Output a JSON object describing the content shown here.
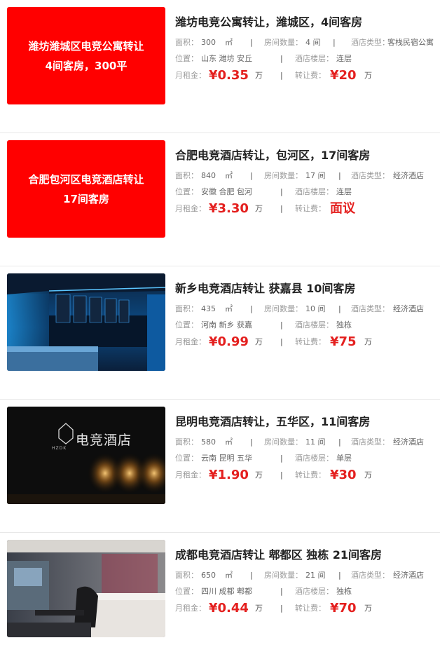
{
  "listings": [
    {
      "thumb": {
        "line1": "潍坊潍城区电竞公寓转让",
        "line2": "4间客房，300平"
      },
      "title": "潍坊电竞公寓转让，潍城区，4间客房",
      "area_label": "面积：",
      "area_value": "300",
      "area_unit": "㎡",
      "rooms_label": "房间数量：",
      "rooms_value": "4 间",
      "type_label": "酒店类型：",
      "type_value": "客栈民宿公寓",
      "location_label": "位置：",
      "location_value": "山东 潍坊 安丘",
      "floor_label": "酒店楼层：",
      "floor_value": "连层",
      "rent_label": "月租金：",
      "rent_value": "¥0.35",
      "rent_unit": "万",
      "fee_label": "转让费：",
      "fee_value": "¥20",
      "fee_unit": "万"
    },
    {
      "thumb": {
        "line1": "合肥包河区电竞酒店转让",
        "line2": "17间客房"
      },
      "title": "合肥电竞酒店转让，包河区，17间客房",
      "area_label": "面积：",
      "area_value": "840",
      "area_unit": "㎡",
      "rooms_label": "房间数量：",
      "rooms_value": "17 间",
      "type_label": "酒店类型：",
      "type_value": "经济酒店",
      "location_label": "位置：",
      "location_value": "安徽 合肥 包河",
      "floor_label": "酒店楼层：",
      "floor_value": "连层",
      "rent_label": "月租金：",
      "rent_value": "¥3.30",
      "rent_unit": "万",
      "fee_label": "转让费：",
      "fee_value": "面议",
      "fee_unit": ""
    },
    {
      "title": "新乡电竞酒店转让 获嘉县 10间客房",
      "area_label": "面积：",
      "area_value": "435",
      "area_unit": "㎡",
      "rooms_label": "房间数量：",
      "rooms_value": "10 间",
      "type_label": "酒店类型：",
      "type_value": "经济酒店",
      "location_label": "位置：",
      "location_value": "河南 新乡 获嘉",
      "floor_label": "酒店楼层：",
      "floor_value": "独栋",
      "rent_label": "月租金：",
      "rent_value": "¥0.99",
      "rent_unit": "万",
      "fee_label": "转让费：",
      "fee_value": "¥75",
      "fee_unit": "万"
    },
    {
      "thumb": {
        "logo_text": "电竞酒店",
        "logo_small": "HZDK"
      },
      "title": "昆明电竞酒店转让，五华区，11间客房",
      "area_label": "面积：",
      "area_value": "580",
      "area_unit": "㎡",
      "rooms_label": "房间数量：",
      "rooms_value": "11 间",
      "type_label": "酒店类型：",
      "type_value": "经济酒店",
      "location_label": "位置：",
      "location_value": "云南 昆明 五华",
      "floor_label": "酒店楼层：",
      "floor_value": "单层",
      "rent_label": "月租金：",
      "rent_value": "¥1.90",
      "rent_unit": "万",
      "fee_label": "转让费：",
      "fee_value": "¥30",
      "fee_unit": "万"
    },
    {
      "title": "成都电竞酒店转让 郫都区 独栋 21间客房",
      "area_label": "面积：",
      "area_value": "650",
      "area_unit": "㎡",
      "rooms_label": "房间数量：",
      "rooms_value": "21 间",
      "type_label": "酒店类型：",
      "type_value": "经济酒店",
      "location_label": "位置：",
      "location_value": "四川 成都 郫都",
      "floor_label": "酒店楼层：",
      "floor_value": "独栋",
      "rent_label": "月租金：",
      "rent_value": "¥0.44",
      "rent_unit": "万",
      "fee_label": "转让费：",
      "fee_value": "¥70",
      "fee_unit": "万"
    }
  ],
  "separator": "|",
  "colors": {
    "price": "#e4201f",
    "thumb_red": "#ff0000",
    "divider": "#e8e8e8"
  }
}
